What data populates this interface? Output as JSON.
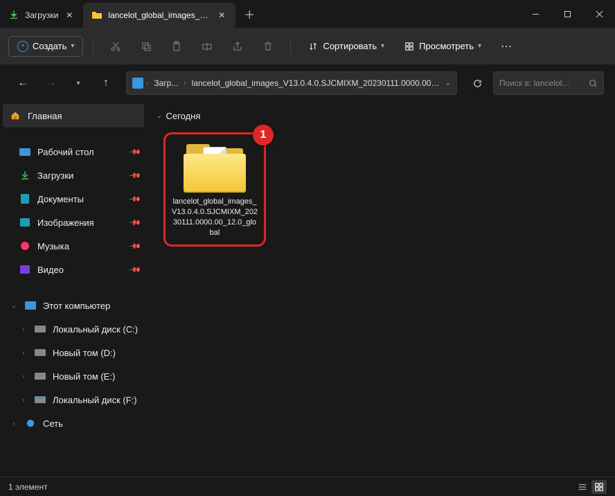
{
  "tabs": [
    {
      "label": "Загрузки",
      "active": false
    },
    {
      "label": "lancelot_global_images_V13.0",
      "active": true
    }
  ],
  "toolbar": {
    "create": "Создать",
    "sort": "Сортировать",
    "view": "Просмотреть"
  },
  "breadcrumb": {
    "seg1": "Загр...",
    "seg2": "lancelot_global_images_V13.0.4.0.SJCMIXM_20230111.0000.00_1..."
  },
  "search_placeholder": "Поиск в: lancelot...",
  "sidebar": {
    "home": "Главная",
    "quick": [
      {
        "label": "Рабочий стол"
      },
      {
        "label": "Загрузки"
      },
      {
        "label": "Документы"
      },
      {
        "label": "Изображения"
      },
      {
        "label": "Музыка"
      },
      {
        "label": "Видео"
      }
    ],
    "this_pc": "Этот компьютер",
    "drives": [
      {
        "label": "Локальный диск (C:)"
      },
      {
        "label": "Новый том (D:)"
      },
      {
        "label": "Новый том (E:)"
      },
      {
        "label": "Локальный диск (F:)"
      }
    ],
    "network": "Сеть"
  },
  "content": {
    "group": "Сегодня",
    "badge": "1",
    "item_name": "lancelot_global_images_V13.0.4.0.SJCMIXM_20230111.0000.00_12.0_global"
  },
  "status": {
    "count": "1 элемент"
  }
}
